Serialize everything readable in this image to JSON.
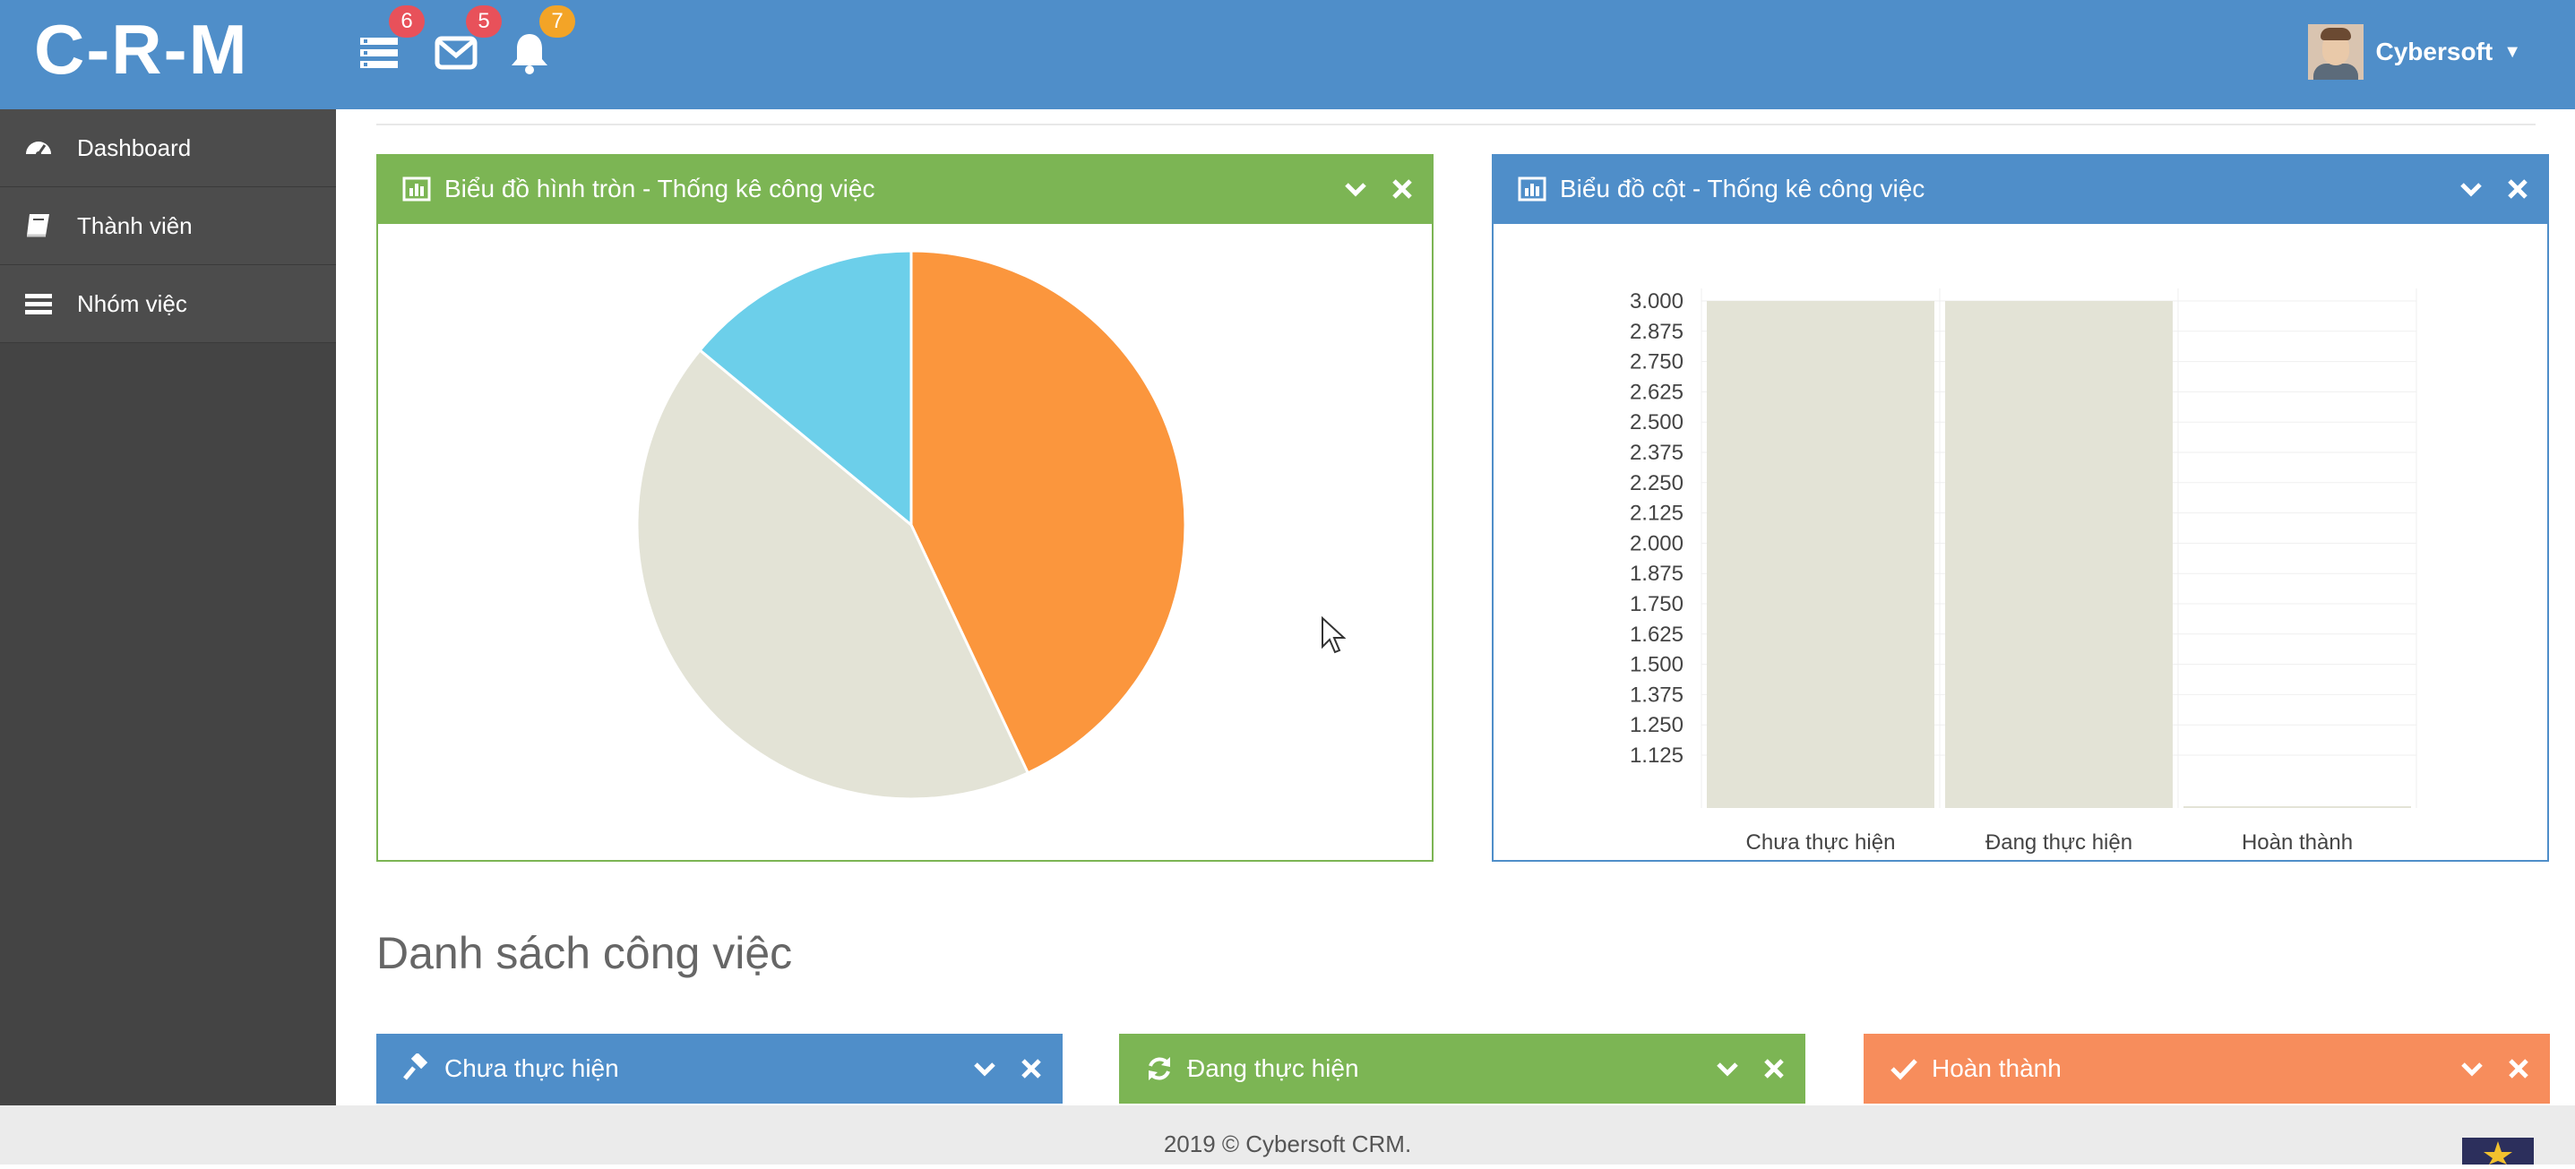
{
  "header": {
    "logo": "C-R-M",
    "icons": [
      {
        "name": "tasks-icon",
        "badge": "6",
        "badge_color": "#e8515a"
      },
      {
        "name": "envelope-icon",
        "badge": "5",
        "badge_color": "#e8515a"
      },
      {
        "name": "bell-icon",
        "badge": "7",
        "badge_color": "#f3a427"
      }
    ],
    "user_name": "Cybersoft",
    "background": "#4f8ec9"
  },
  "sidebar": {
    "items": [
      {
        "label": "Dashboard",
        "icon": "dashboard-icon"
      },
      {
        "label": "Thành viên",
        "icon": "book-icon"
      },
      {
        "label": "Nhóm việc",
        "icon": "list-icon"
      }
    ]
  },
  "pie_panel": {
    "title": "Biểu đồ hình tròn - Thống kê công việc",
    "color": "#7cb554"
  },
  "bar_panel": {
    "title": "Biểu đồ cột - Thống kê công việc",
    "color": "#4f8ec9"
  },
  "section_title": "Danh sách công việc",
  "task_panels": [
    {
      "title": "Chưa thực hiện",
      "icon": "gavel-icon",
      "color": "#4f8ec9"
    },
    {
      "title": "Đang thực hiện",
      "icon": "refresh-icon",
      "color": "#7cb554"
    },
    {
      "title": "Hoàn thành",
      "icon": "check-icon",
      "color": "#f78d5c"
    }
  ],
  "footer": {
    "text": "2019 © Cybersoft CRM."
  },
  "chart_data": [
    {
      "type": "pie",
      "slices": [
        {
          "label": "Chưa thực hiện",
          "value": 43,
          "color": "#e3e3d6"
        },
        {
          "label": "Đang thực hiện",
          "value": 43,
          "color": "#fb963d"
        },
        {
          "label": "Hoàn thành",
          "value": 14,
          "color": "#6ccfea"
        }
      ]
    },
    {
      "type": "bar",
      "categories": [
        "Chưa thực hiện",
        "Đang thực hiện",
        "Hoàn thành"
      ],
      "values": [
        3,
        3,
        1
      ],
      "bar_color": "#e3e3d6",
      "ylim": [
        1,
        3
      ],
      "yticks": [
        "3.000",
        "2.875",
        "2.750",
        "2.625",
        "2.500",
        "2.375",
        "2.250",
        "2.125",
        "2.000",
        "1.875",
        "1.750",
        "1.625",
        "1.500",
        "1.375",
        "1.250",
        "1.125"
      ],
      "grid": true
    }
  ]
}
